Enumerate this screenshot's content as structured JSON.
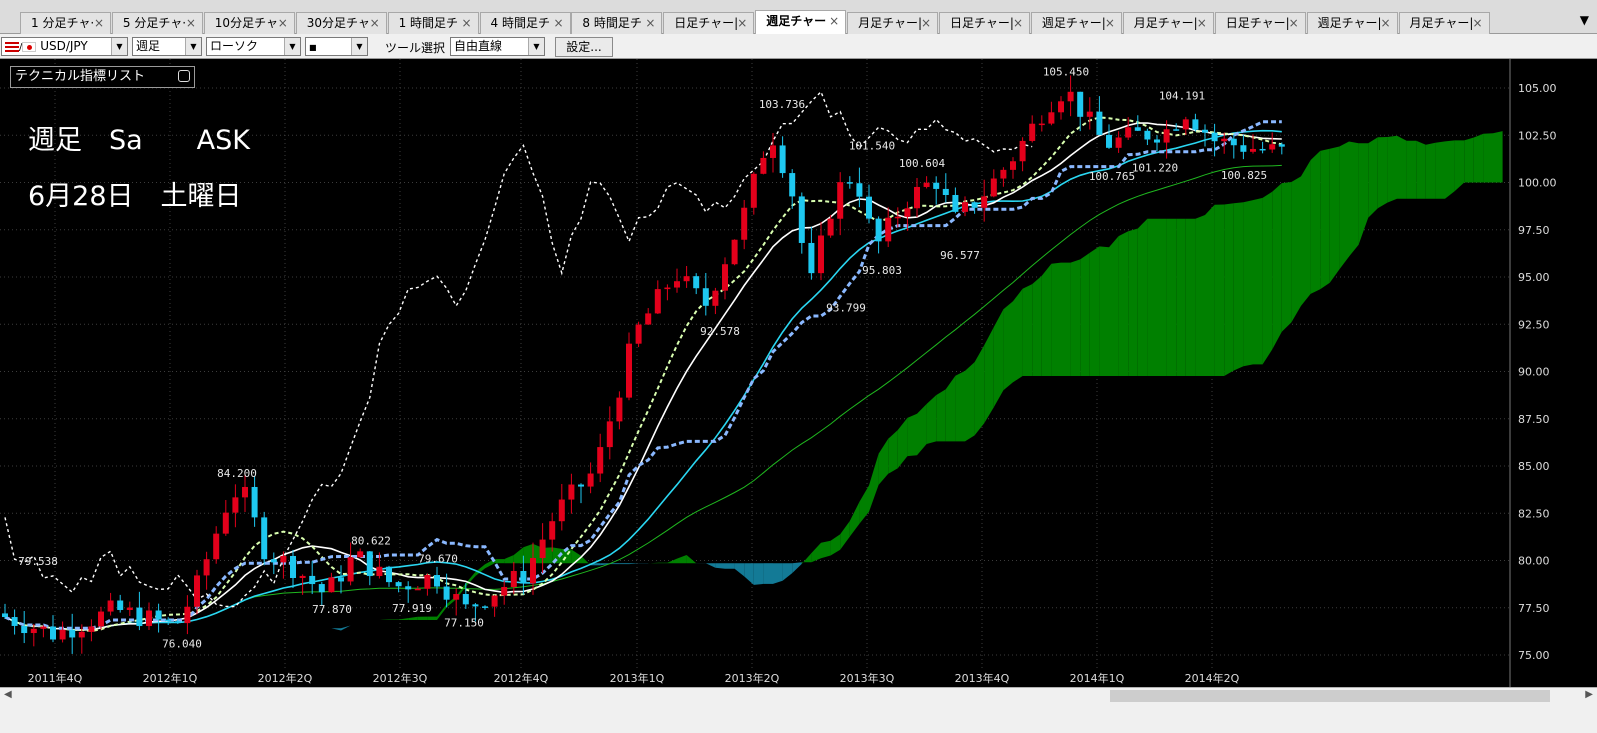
{
  "tabs": [
    {
      "label": "1 分足チャ·",
      "active": false
    },
    {
      "label": "5 分足チャ·",
      "active": false
    },
    {
      "label": "10分足チャ",
      "active": false
    },
    {
      "label": "30分足チャ",
      "active": false
    },
    {
      "label": "1 時間足チ",
      "active": false
    },
    {
      "label": "4 時間足チ",
      "active": false
    },
    {
      "label": "8 時間足チ",
      "active": false
    },
    {
      "label": "日足チャー|",
      "active": false
    },
    {
      "label": "週足チャー",
      "active": true
    },
    {
      "label": "月足チャー|",
      "active": false
    },
    {
      "label": "日足チャー|",
      "active": false
    },
    {
      "label": "週足チャー|",
      "active": false
    },
    {
      "label": "月足チャー|",
      "active": false
    },
    {
      "label": "日足チャー|",
      "active": false
    },
    {
      "label": "週足チャー|",
      "active": false
    },
    {
      "label": "月足チャー|",
      "active": false
    }
  ],
  "tab_menu_icon": "▼",
  "toolbar": {
    "currency": "USD/JPY",
    "period": "週足",
    "chart_type": "ローソク",
    "marker": "■",
    "tool_label": "ツール選択",
    "tool": "自由直線",
    "settings_label": "設定..."
  },
  "indicator_list_label": "テクニカル指標リスト",
  "overlay": {
    "line1": "週足　Sa　　ASK",
    "line2": "6月28日　土曜日"
  },
  "colors": {
    "up_candle": "#e3001b",
    "down_candle": "#1ec8f0",
    "kumo_bull": "#008000",
    "kumo_bear": "#137a96",
    "grid": "#3c3c3c"
  },
  "chart_data": {
    "type": "candlestick",
    "ylim": [
      74.5,
      106.2
    ],
    "y_ticks": [
      "105.00",
      "102.50",
      "100.00",
      "97.50",
      "95.00",
      "92.50",
      "90.00",
      "87.50",
      "85.00",
      "82.50",
      "80.00",
      "77.50",
      "75.00"
    ],
    "x_labels": [
      "2011年4Q",
      "2012年1Q",
      "2012年2Q",
      "2012年3Q",
      "2012年4Q",
      "2013年1Q",
      "2013年2Q",
      "2013年3Q",
      "2013年4Q",
      "2014年1Q",
      "2014年2Q"
    ],
    "annotations": [
      {
        "text": "84.200",
        "value": 84.2
      },
      {
        "text": "76.040",
        "value": 76.04
      },
      {
        "text": "79.538",
        "value": 79.538
      },
      {
        "text": "77.870",
        "value": 77.87
      },
      {
        "text": "80.622",
        "value": 80.622
      },
      {
        "text": "77.919",
        "value": 77.919
      },
      {
        "text": "79.670",
        "value": 79.67
      },
      {
        "text": "77.150",
        "value": 77.15
      },
      {
        "text": "92.578",
        "value": 92.578
      },
      {
        "text": "103.736",
        "value": 103.736
      },
      {
        "text": "93.799",
        "value": 93.799
      },
      {
        "text": "101.540",
        "value": 101.54
      },
      {
        "text": "95.803",
        "value": 95.803
      },
      {
        "text": "100.604",
        "value": 100.604
      },
      {
        "text": "96.577",
        "value": 96.577
      },
      {
        "text": "105.450",
        "value": 105.45
      },
      {
        "text": "100.765",
        "value": 100.765
      },
      {
        "text": "104.191",
        "value": 104.191
      },
      {
        "text": "101.220",
        "value": 101.22
      },
      {
        "text": "100.825",
        "value": 100.825
      }
    ],
    "grid": true
  }
}
